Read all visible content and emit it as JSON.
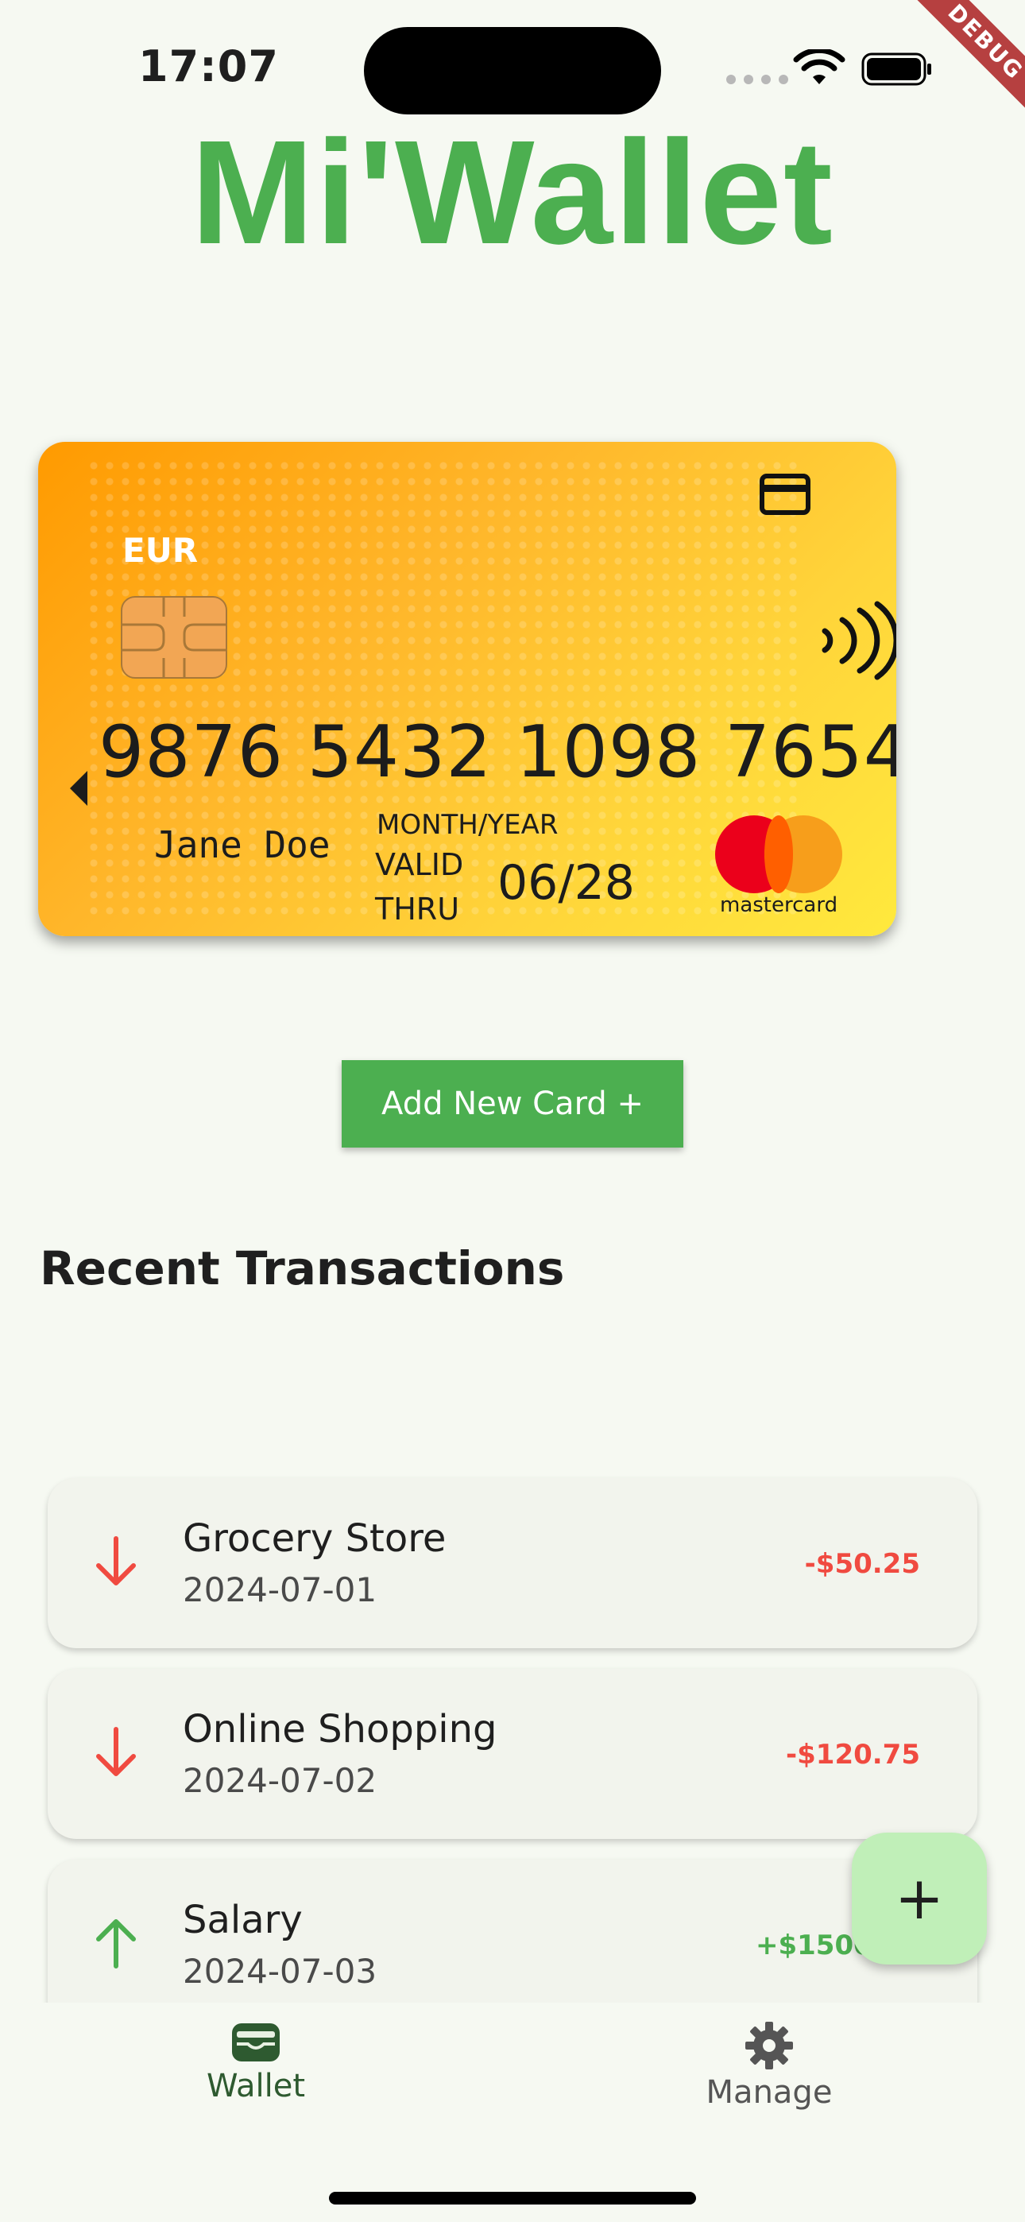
{
  "status_bar": {
    "time": "17:07",
    "debug_label": "DEBUG"
  },
  "app": {
    "title": "Mi'Wallet"
  },
  "card": {
    "currency": "EUR",
    "number": "9876 5432 1098 7654",
    "holder": "Jane  Doe",
    "month_year_label": "MONTH/YEAR",
    "valid_label": "VALID",
    "thru_label": "THRU",
    "expiry": "06/28",
    "brand": "mastercard",
    "colors": {
      "gradient_start": "#ff9a00",
      "gradient_end": "#ffe93d"
    }
  },
  "actions": {
    "add_card_label": "Add New Card +"
  },
  "transactions": {
    "title": "Recent Transactions",
    "items": [
      {
        "title": "Grocery Store",
        "date": "2024-07-01",
        "amount": "-$50.25",
        "direction": "down"
      },
      {
        "title": "Online Shopping",
        "date": "2024-07-02",
        "amount": "-$120.75",
        "direction": "down"
      },
      {
        "title": "Salary",
        "date": "2024-07-03",
        "amount": "+$1500.00",
        "direction": "up"
      }
    ]
  },
  "fab": {
    "label": "+"
  },
  "nav": {
    "items": [
      {
        "label": "Wallet",
        "icon": "wallet-icon",
        "active": true
      },
      {
        "label": "Manage",
        "icon": "gear-icon",
        "active": false
      }
    ]
  },
  "colors": {
    "accent": "#4caf50",
    "negative": "#f04a40",
    "background": "#f6f9f2"
  }
}
